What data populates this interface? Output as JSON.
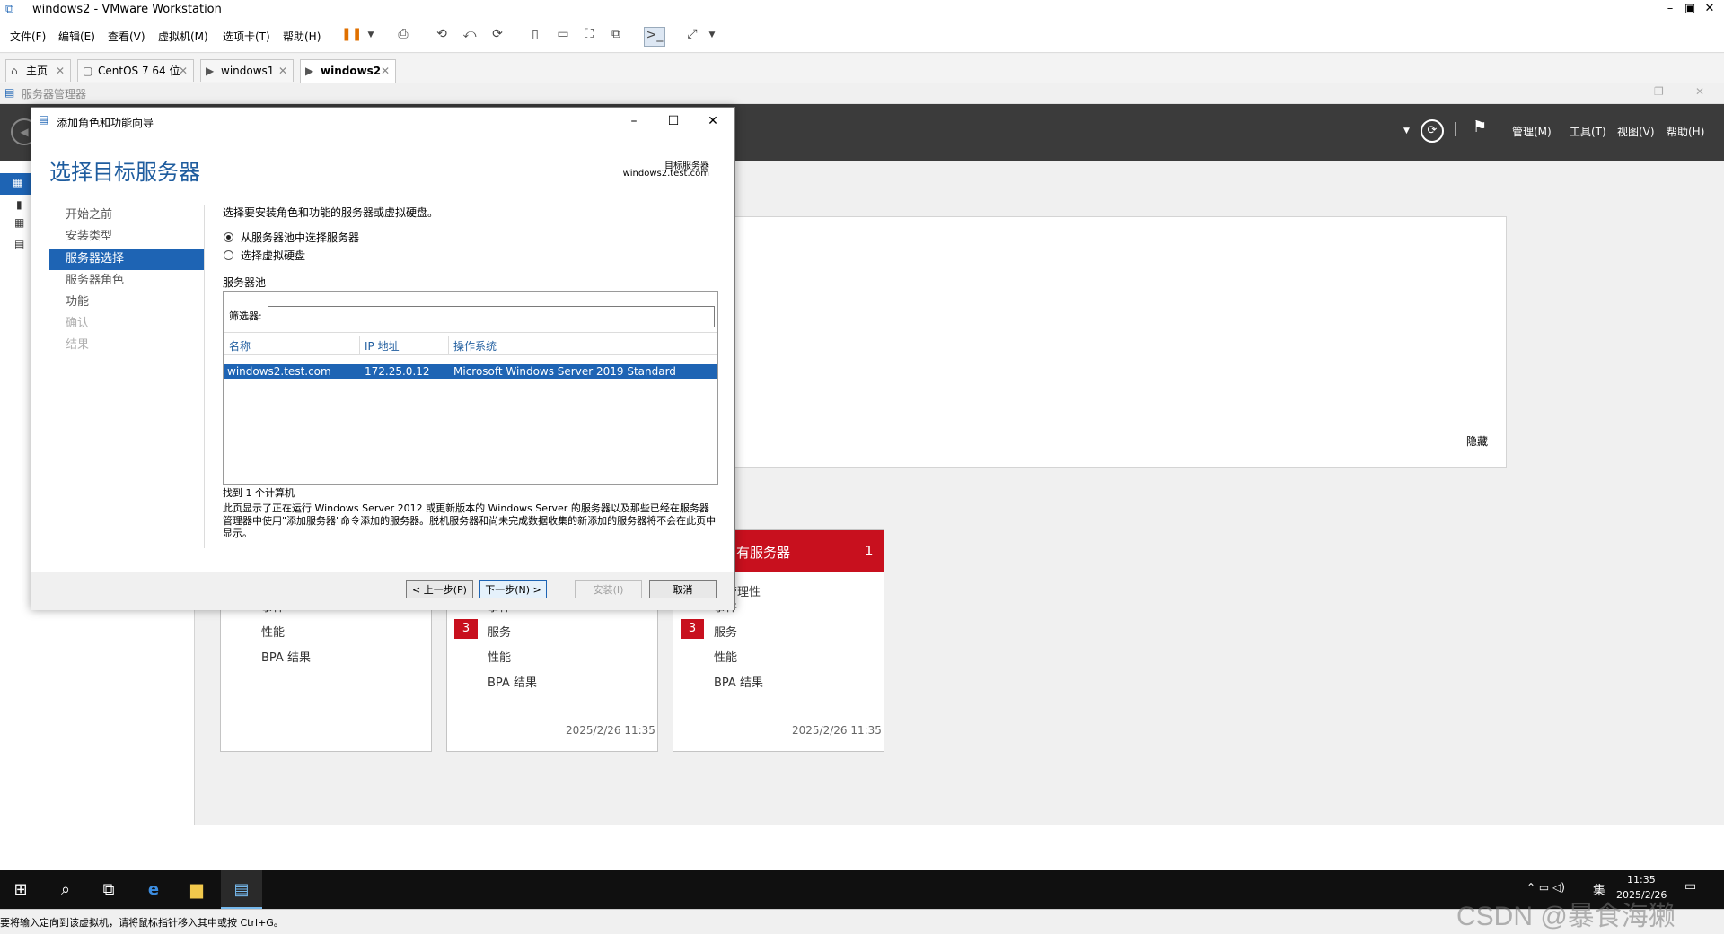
{
  "vmware": {
    "title": "windows2 - VMware Workstation",
    "menu": [
      "文件(F)",
      "编辑(E)",
      "查看(V)",
      "虚拟机(M)",
      "选项卡(T)",
      "帮助(H)"
    ],
    "tabs": [
      {
        "label": "主页",
        "icon": "home-icon"
      },
      {
        "label": "CentOS 7 64 位",
        "icon": "vm-icon"
      },
      {
        "label": "windows1",
        "icon": "vm-running-icon"
      },
      {
        "label": "windows2",
        "icon": "vm-running-icon",
        "active": true
      }
    ],
    "status_text": "要将输入定向到该虚拟机，请将鼠标指针移入其中或按 Ctrl+G。"
  },
  "server_manager": {
    "title": "服务器管理器",
    "header_menu": [
      "管理(M)",
      "工具(T)",
      "视图(V)",
      "帮助(H)"
    ],
    "hide_link": "隐藏",
    "tiles": [
      {
        "rows": [
          "事件",
          "性能",
          "BPA 结果"
        ]
      },
      {
        "rows": [
          "事件",
          "服务",
          "性能",
          "BPA 结果"
        ],
        "service_badge": "3",
        "timestamp": "2025/2/26 11:35"
      },
      {
        "head_title": "有服务器",
        "head_count": "1",
        "rows": [
          "可管理性",
          "事件",
          "服务",
          "性能",
          "BPA 结果"
        ],
        "service_badge": "3",
        "timestamp": "2025/2/26 11:35"
      }
    ]
  },
  "wizard": {
    "window_title": "添加角色和功能向导",
    "heading": "选择目标服务器",
    "target_label": "目标服务器",
    "target_value": "windows2.test.com",
    "steps": [
      {
        "label": "开始之前",
        "state": "normal"
      },
      {
        "label": "安装类型",
        "state": "normal"
      },
      {
        "label": "服务器选择",
        "state": "active"
      },
      {
        "label": "服务器角色",
        "state": "normal"
      },
      {
        "label": "功能",
        "state": "normal"
      },
      {
        "label": "确认",
        "state": "disabled"
      },
      {
        "label": "结果",
        "state": "disabled"
      }
    ],
    "instruction": "选择要安装角色和功能的服务器或虚拟硬盘。",
    "radio_pool": "从服务器池中选择服务器",
    "radio_vhd": "选择虚拟硬盘",
    "pool_title": "服务器池",
    "filter_label": "筛选器:",
    "filter_value": "",
    "columns": [
      "名称",
      "IP 地址",
      "操作系统"
    ],
    "rows": [
      {
        "name": "windows2.test.com",
        "ip": "172.25.0.12",
        "os": "Microsoft Windows Server 2019 Standard"
      }
    ],
    "found_text": "找到 1 个计算机",
    "description": "此页显示了正在运行 Windows Server 2012 或更新版本的 Windows Server 的服务器以及那些已经在服务器管理器中使用\"添加服务器\"命令添加的服务器。脱机服务器和尚未完成数据收集的新添加的服务器将不会在此页中显示。",
    "buttons": {
      "prev": "< 上一步(P)",
      "next": "下一步(N) >",
      "install": "安装(I)",
      "cancel": "取消"
    }
  },
  "taskbar": {
    "time": "11:35",
    "date": "2025/2/26",
    "ime": "集"
  },
  "watermark": "CSDN @暴食海獭"
}
